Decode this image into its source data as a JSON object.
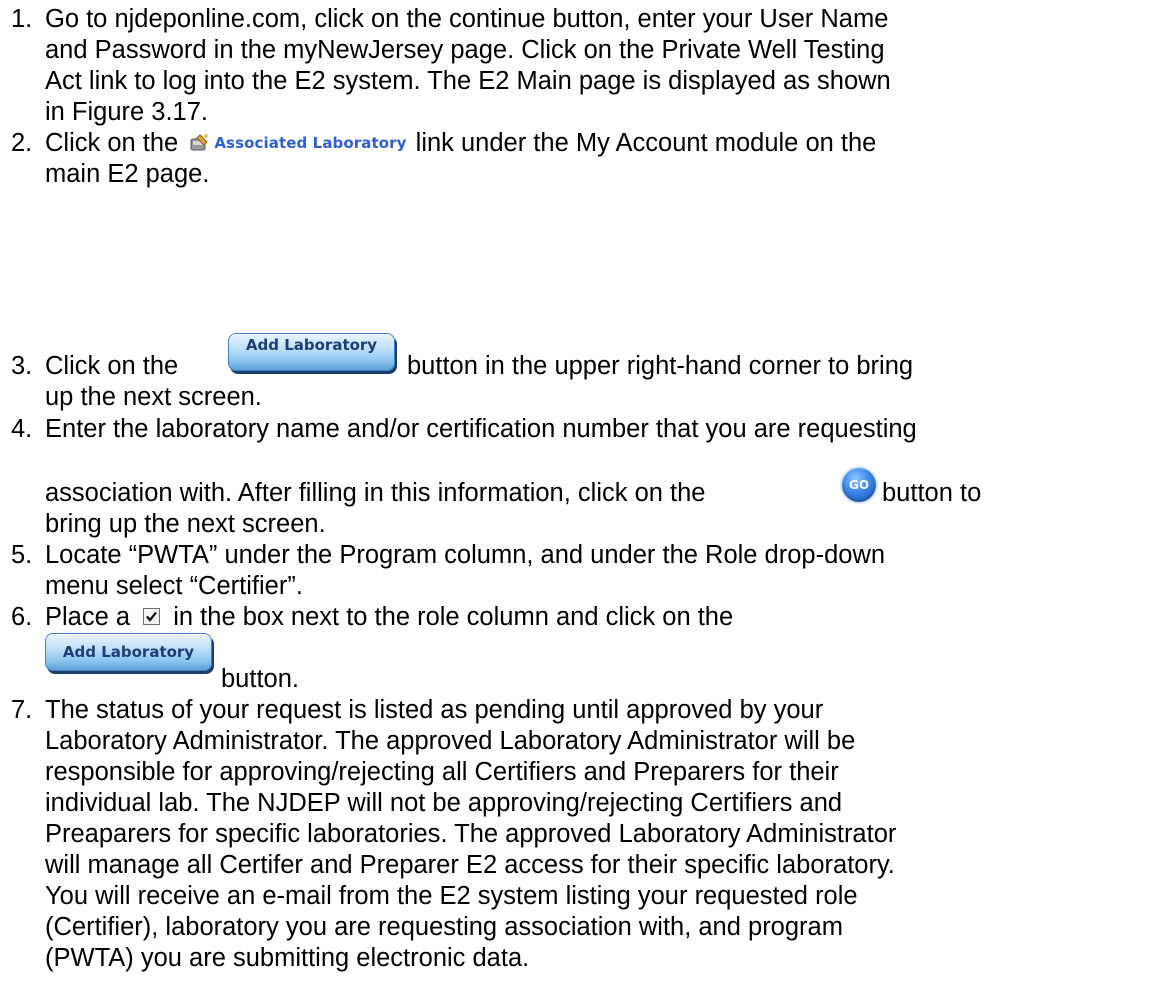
{
  "steps": [
    {
      "num": "1.",
      "lines": [
        "Go to njdeponline.com, click on the continue button, enter your User Name",
        "and Password in the myNewJersey page.  Click on the Private Well Testing",
        "Act link to log into the E2 system.  The E2 Main page is displayed as shown",
        "in Figure 3.17."
      ]
    },
    {
      "num": "2.",
      "before": "Click on the",
      "link_label": "Associated Laboratory",
      "after": "link under the My Account module on the",
      "line2": "main E2 page."
    },
    {
      "num": "3.",
      "before": "Click on the",
      "after": "button in the upper right-hand corner to bring",
      "line2": "up the next screen."
    },
    {
      "num": "4.",
      "line1": "Enter the laboratory name and/or certification number that you are requesting",
      "line2_before": "association with.  After filling in this information, click on the",
      "line2_after": "button to",
      "line3": "bring up the next screen."
    },
    {
      "num": "5.",
      "lines": [
        "Locate “PWTA” under the Program column, and under the Role drop-down",
        "menu select “Certifier”."
      ]
    },
    {
      "num": "6.",
      "before": "Place a",
      "after": "in the box next to the role column and click on the",
      "line2": "button."
    },
    {
      "num": "7.",
      "lines": [
        "The status of your request is listed as pending until approved by your",
        "Laboratory Administrator.  The approved Laboratory Administrator will be",
        "responsible for approving/rejecting all Certifiers and Preparers for their",
        "individual lab.  The NJDEP will not be approving/rejecting Certifiers and",
        "Preaparers for specific laboratories.  The approved Laboratory Administrator",
        "will manage all Certifer and Preparer E2 access for their specific laboratory.",
        "You will receive an e-mail from the E2 system listing your requested role",
        "(Certifier), laboratory you are requesting association with, and program",
        "(PWTA) you are submitting electronic data."
      ]
    }
  ],
  "ui": {
    "add_laboratory_label": "Add Laboratory",
    "go_label": "GO",
    "checkbox_mark": "✓"
  }
}
